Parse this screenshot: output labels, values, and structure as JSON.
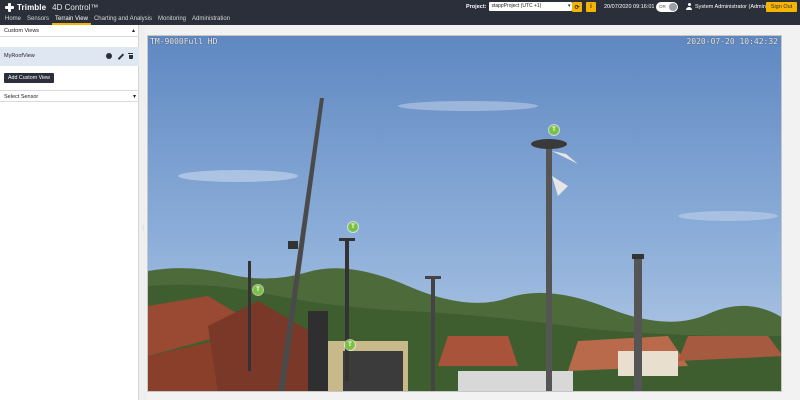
{
  "brand": {
    "name": "Trimble",
    "product": "4D Control™"
  },
  "nav": {
    "tabs": [
      {
        "label": "Home",
        "active": false
      },
      {
        "label": "Sensors",
        "active": false
      },
      {
        "label": "Terrain View",
        "active": true
      },
      {
        "label": "Charting and Analysis",
        "active": false
      },
      {
        "label": "Monitoring",
        "active": false
      },
      {
        "label": "Administration",
        "active": false
      }
    ]
  },
  "header": {
    "project_label": "Project:",
    "project_value": "stappProject (UTC +1)",
    "datetime": "20/07/2020 09:16:01",
    "toggle_label": "OR",
    "user": "System Administrator (Admin)",
    "sign_out": "Sign Out",
    "colors": {
      "bar": "#2b2f3a",
      "accent": "#f5b400"
    }
  },
  "sidebar": {
    "custom_views_title": "Custom Views",
    "views": [
      {
        "name": "MyRoofView"
      }
    ],
    "add_view_label": "Add Custom View",
    "select_sensor_label": "Select Sensor"
  },
  "feed": {
    "camera_id": "TM-9000Full HD",
    "timestamp": "2020-07-20 10:42:32",
    "markers": [
      {
        "label": "T"
      },
      {
        "label": "T"
      },
      {
        "label": "T"
      },
      {
        "label": "T"
      }
    ],
    "marker_color": "#7cc242"
  }
}
